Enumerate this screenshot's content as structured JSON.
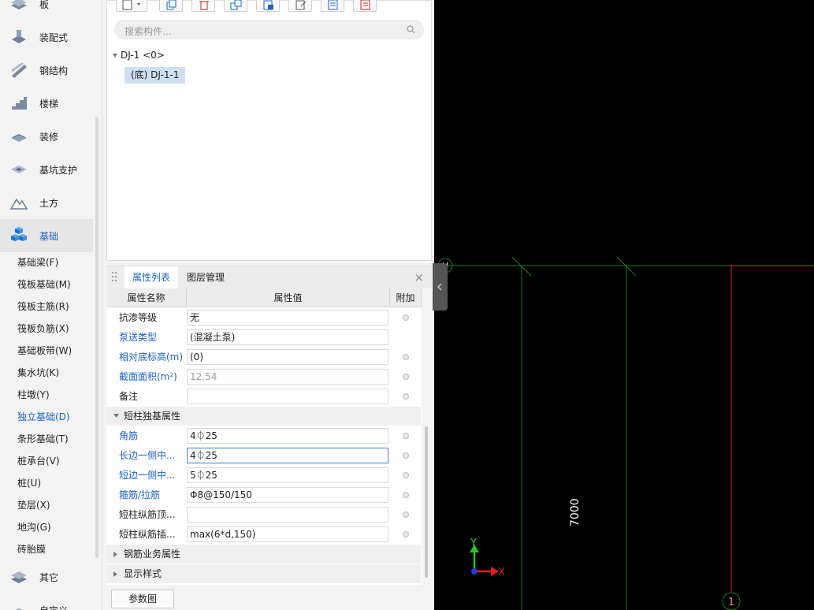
{
  "nav": {
    "categories": [
      {
        "label": "板",
        "icon": "slab-icon"
      },
      {
        "label": "装配式",
        "icon": "prefab-icon"
      },
      {
        "label": "钢结构",
        "icon": "steel-icon"
      },
      {
        "label": "楼梯",
        "icon": "stairs-icon"
      },
      {
        "label": "装修",
        "icon": "decoration-icon"
      },
      {
        "label": "基坑支护",
        "icon": "pit-support-icon"
      },
      {
        "label": "土方",
        "icon": "earthwork-icon"
      },
      {
        "label": "基础",
        "icon": "foundation-icon"
      },
      {
        "label": "其它",
        "icon": "other-icon"
      },
      {
        "label": "自定义",
        "icon": "custom-icon"
      }
    ],
    "subitems": [
      "基础梁(F)",
      "筏板基础(M)",
      "筏板主筋(R)",
      "筏板负筋(X)",
      "基础板带(W)",
      "集水坑(K)",
      "柱墩(Y)",
      "独立基础(D)",
      "条形基础(T)",
      "桩承台(V)",
      "桩(U)",
      "垫层(X)",
      "地沟(G)",
      "砖胎膜"
    ],
    "active_category": "基础",
    "active_subitem": "独立基础(D)",
    "accent": "#1a63c8"
  },
  "tree": {
    "search_placeholder": "搜索构件...",
    "root": "DJ-1 <0>",
    "child": "(底) DJ-1-1"
  },
  "props": {
    "tabs": [
      "属性列表",
      "图层管理"
    ],
    "close": "×",
    "headers": {
      "name": "属性名称",
      "value": "属性值",
      "extra": "附加"
    },
    "rows": [
      {
        "name": "抗渗等级",
        "value": "无",
        "blue": false,
        "grey": false,
        "dot": true
      },
      {
        "name": "泵送类型",
        "value": "(混凝土泵)",
        "blue": true,
        "grey": false,
        "dot": false
      },
      {
        "name": "相对底标高(m)",
        "value": "(0)",
        "blue": true,
        "grey": false,
        "dot": true
      },
      {
        "name": "截面面积(m²)",
        "value": "12.54",
        "blue": true,
        "grey": true,
        "dot": true
      },
      {
        "name": "备注",
        "value": "",
        "blue": false,
        "grey": false,
        "dot": true
      }
    ],
    "group1": "短柱独基属性",
    "group_rows": [
      {
        "name": "角筋",
        "value": "4⏀25",
        "blue": true,
        "dot": true,
        "focus": false
      },
      {
        "name": "长边一侧中...",
        "value": "4⏀25",
        "blue": true,
        "dot": true,
        "focus": true
      },
      {
        "name": "短边一侧中...",
        "value": "5⏀25",
        "blue": true,
        "dot": true,
        "focus": false
      },
      {
        "name": "箍筋/拉筋",
        "value": "Φ8@150/150",
        "blue": true,
        "dot": true,
        "focus": false
      },
      {
        "name": "短柱纵筋顶...",
        "value": "",
        "blue": false,
        "dot": true,
        "focus": false
      },
      {
        "name": "短柱纵筋插...",
        "value": "max(6*d,150)",
        "blue": false,
        "dot": true,
        "focus": false
      }
    ],
    "group2": "钢筋业务属性",
    "group3": "显示样式",
    "param_button": "参数图"
  },
  "canvas": {
    "axis_h": "H",
    "axis_1": "1",
    "dimension": "7000",
    "y_label": "Y",
    "x_label": "X",
    "grid_color": "#1f7a1f",
    "axis_color": "#c81e1e"
  }
}
